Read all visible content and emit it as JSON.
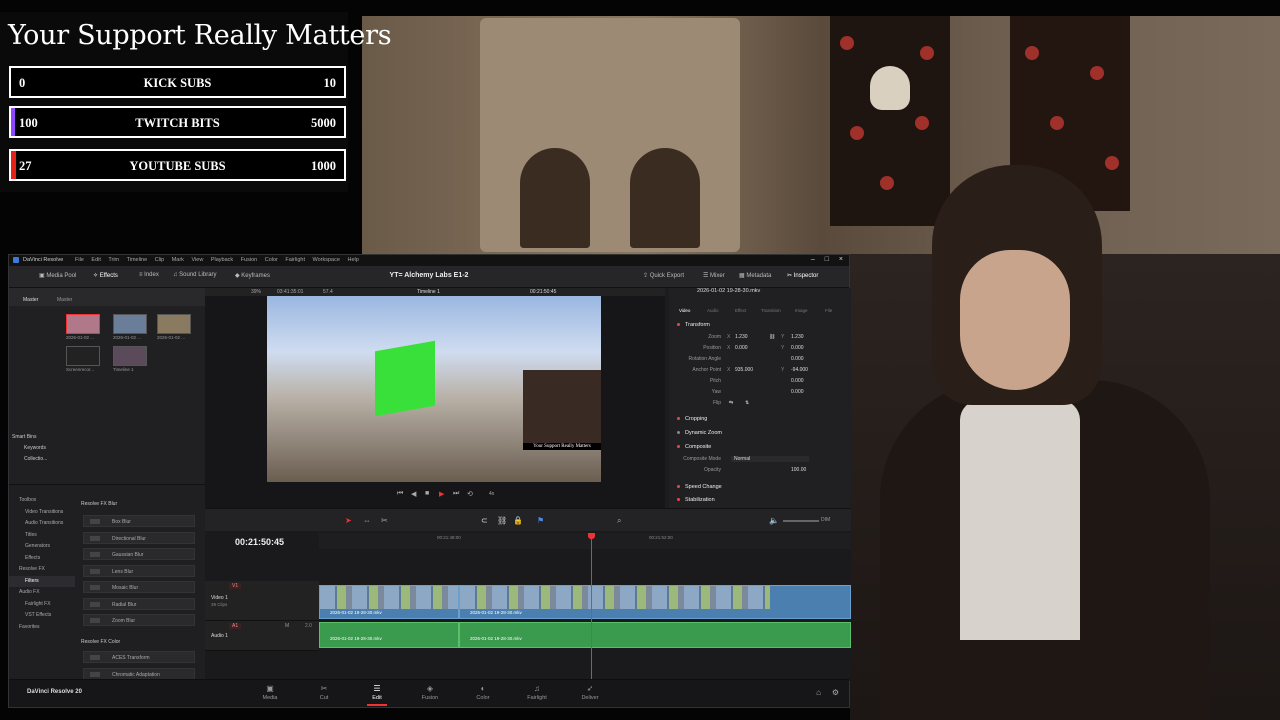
{
  "goals": {
    "title": "Your Support Really Matters",
    "items": [
      {
        "min": "0",
        "label": "KICK SUBS",
        "max": "10",
        "color": "#4caf50",
        "progress": 0.0
      },
      {
        "min": "100",
        "label": "TWITCH BITS",
        "max": "5000",
        "color": "#9146ff",
        "progress": 0.02
      },
      {
        "min": "27",
        "label": "YOUTUBE SUBS",
        "max": "1000",
        "color": "#e62117",
        "progress": 0.027
      }
    ]
  },
  "resolve": {
    "app_name": "DaVinci Resolve",
    "menus": [
      "File",
      "Edit",
      "Trim",
      "Timeline",
      "Clip",
      "Mark",
      "View",
      "Playback",
      "Fusion",
      "Color",
      "Fairlight",
      "Workspace",
      "Help"
    ],
    "toolbar": {
      "media_pool": "Media Pool",
      "effects": "Effects",
      "index": "Index",
      "sound_library": "Sound Library",
      "keyframes": "Keyframes",
      "project_title": "YT= Alchemy Labs E1-2",
      "quick_export": "Quick Export",
      "mixer": "Mixer",
      "metadata": "Metadata",
      "inspector": "Inspector"
    },
    "media_pool": {
      "tabs": [
        "Master",
        "Master"
      ],
      "clips": [
        "2026-01-02 ...",
        "2026-01-02 ...",
        "2026-01-02 ...",
        "Screenrecor...",
        "Timeline 1"
      ],
      "smart_bins": "Smart Bins",
      "bins": [
        "Keywords",
        "Collectio..."
      ]
    },
    "viewer": {
      "zoom": "39%",
      "timecode_left": "03:41:35:01",
      "fps": "57.4",
      "timeline_name": "Timeline 1",
      "timecode_right": "00:21:50:45",
      "cam_caption": "Your Support Really Matters",
      "speed": "4x"
    },
    "inspector": {
      "clip_name": "2026-01-02 19-28-30.mkv",
      "tabs": [
        "Video",
        "Audio",
        "Effect",
        "Transition",
        "Image",
        "File"
      ],
      "sections": {
        "transform": "Transform",
        "cropping": "Cropping",
        "dynamic_zoom": "Dynamic Zoom",
        "composite": "Composite",
        "speed_change": "Speed Change",
        "stabilization": "Stabilization"
      },
      "zoom_label": "Zoom",
      "zoom_x": "1.230",
      "zoom_y": "1.230",
      "position_label": "Position",
      "pos_x": "0.000",
      "pos_y": "0.000",
      "rotation_label": "Rotation Angle",
      "rotation": "0.000",
      "anchor_label": "Anchor Point",
      "anchor_x": "935.000",
      "anchor_y": "-94.000",
      "pitch_label": "Pitch",
      "pitch": "0.000",
      "yaw_label": "Yaw",
      "yaw": "0.000",
      "flip_label": "Flip",
      "composite_mode_label": "Composite Mode",
      "composite_mode": "Normal",
      "opacity_label": "Opacity",
      "opacity": "100.00",
      "axis_x": "X",
      "axis_y": "Y"
    },
    "effects": {
      "tree": [
        "Toolbox",
        "Video Transitions",
        "Audio Transitions",
        "Titles",
        "Generators",
        "Effects",
        "Resolve FX",
        "Filters",
        "Audio FX",
        "Fairlight FX",
        "VST Effects",
        "Favorites"
      ],
      "group1": "Resolve FX Blur",
      "items1": [
        "Box Blur",
        "Directional Blur",
        "Gaussian Blur",
        "Lens Blur",
        "Mosaic Blur",
        "Radial Blur",
        "Zoom Blur"
      ],
      "group2": "Resolve FX Color",
      "items2": [
        "ACES Transform",
        "Chromatic Adaptation"
      ]
    },
    "timeline": {
      "timecode": "00:21:50:45",
      "ruler": [
        "00:21:48:00",
        "00:21:52:00"
      ],
      "v1": "V1",
      "video_track": "Video 1",
      "clip_count": "39 Clips",
      "a1": "A1",
      "audio_track": "Audio 1",
      "audio_level": "2.0",
      "clip_name": "2026-01-02 19-28-30.mkv",
      "dim": "DIM"
    },
    "pages": {
      "brand": "DaVinci Resolve 20",
      "media": "Media",
      "cut": "Cut",
      "edit": "Edit",
      "fusion": "Fusion",
      "color": "Color",
      "fairlight": "Fairlight",
      "deliver": "Deliver"
    }
  }
}
